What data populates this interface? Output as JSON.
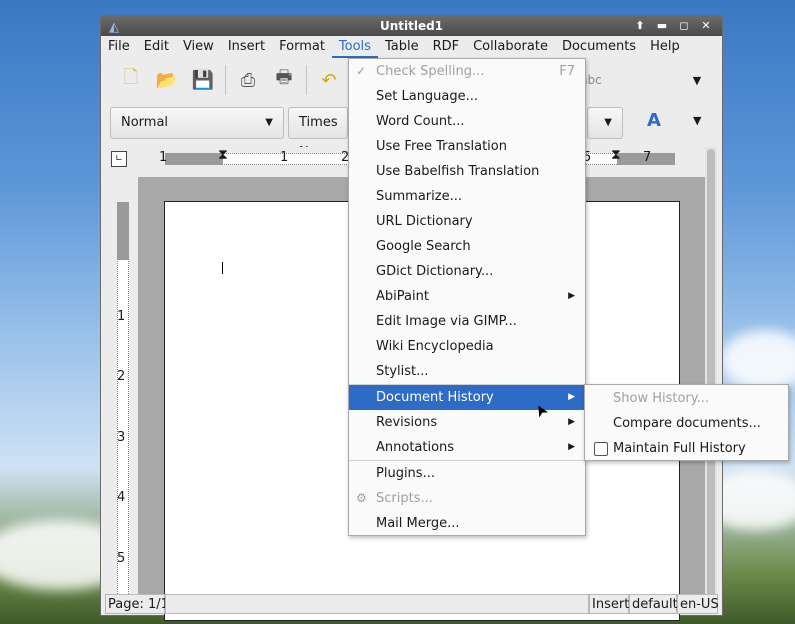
{
  "window": {
    "title": "Untitled1"
  },
  "menubar": [
    "File",
    "Edit",
    "View",
    "Insert",
    "Format",
    "Tools",
    "Table",
    "RDF",
    "Collaborate",
    "Documents",
    "Help"
  ],
  "toolbar": {
    "style_combo": "Normal",
    "font_combo": "Times N"
  },
  "ruler_h": {
    "labels": [
      "1",
      "1",
      "2",
      "5",
      "7"
    ]
  },
  "ruler_v": {
    "labels": [
      "1",
      "2",
      "3",
      "4",
      "5"
    ]
  },
  "tools_menu": {
    "check_spelling": "Check Spelling...",
    "check_spelling_shortcut": "F7",
    "set_language": "Set Language...",
    "word_count": "Word Count...",
    "free_translation": "Use Free Translation",
    "babelfish": "Use Babelfish Translation",
    "summarize": "Summarize...",
    "url_dictionary": "URL Dictionary",
    "google_search": "Google Search",
    "gdict": "GDict Dictionary...",
    "abipaint": "AbiPaint",
    "edit_gimp": "Edit Image via GIMP...",
    "wiki": "Wiki Encyclopedia",
    "stylist": "Stylist...",
    "document_history": "Document History",
    "revisions": "Revisions",
    "annotations": "Annotations",
    "plugins": "Plugins...",
    "scripts": "Scripts...",
    "mail_merge": "Mail Merge..."
  },
  "history_submenu": {
    "show_history": "Show History...",
    "compare_documents": "Compare documents...",
    "maintain_full_history": "Maintain Full History",
    "maintain_full_history_checked": false
  },
  "statusbar": {
    "page": "Page: 1/1",
    "mode": "Insert",
    "style": "default",
    "language": "en-US"
  },
  "colors": {
    "accent": "#2e6bc6",
    "titlebar": "#555555"
  }
}
